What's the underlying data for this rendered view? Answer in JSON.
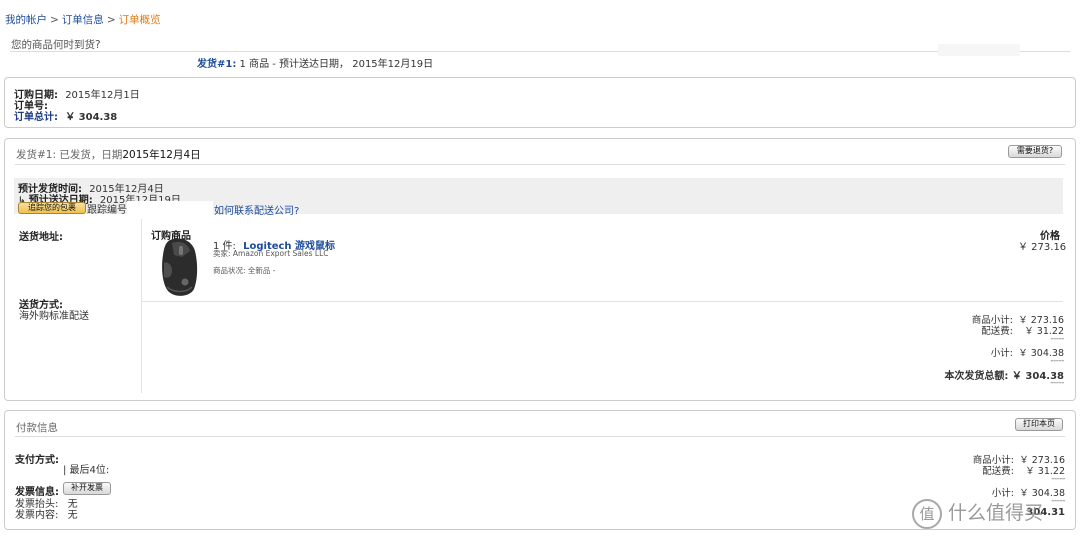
{
  "breadcrumb": {
    "account": "我的帐户",
    "order_info": "订单信息",
    "current": "订单概览",
    "sep": ">"
  },
  "delivery_question": "您的商品何时到货?",
  "shipment_summary": {
    "label": "发货#1:",
    "text": "1 商品 - 预计送达日期， 2015年12月19日"
  },
  "order_box": {
    "date_label": "订购日期:",
    "date_value": "2015年12月1日",
    "number_label": "订单号:",
    "number_value": "",
    "total_label": "订单总计:",
    "total_value": "￥ 304.38"
  },
  "shipment": {
    "header_prefix": "发货#1: 已发货，日期",
    "header_date": "2015年12月4日",
    "return_button": "需要退货?",
    "ship_time_label": "预计发货时间:",
    "ship_time_value": "2015年12月4日",
    "arrive_label": "预计送达日期:",
    "arrive_value": "2015年12月19日",
    "track_button": "追踪您的包裹",
    "tracking_label": "跟踪编号",
    "carrier_link": "如何联系配送公司?",
    "address_label": "送货地址:",
    "method_label": "送货方式:",
    "method_value": "海外购标准配送",
    "items_header": "订购商品",
    "price_header": "价格",
    "item_qty": "1 件:",
    "item_name": "Logitech 游戏鼠标",
    "seller": "卖家: Amazon Export Sales LLC",
    "condition": "商品状况: 全新品 -",
    "item_price": "￥ 273.16",
    "subtotal_label": "商品小计:",
    "subtotal_value": "￥ 273.16",
    "shipping_label": "配送费:",
    "shipping_value": "￥ 31.22",
    "sum_label": "小计:",
    "sum_value": "￥ 304.38",
    "total_label": "本次发货总额:",
    "total_value": "￥ 304.38",
    "dashes": "-----"
  },
  "payment": {
    "header": "付款信息",
    "print_button": "打印本页",
    "method_label": "支付方式:",
    "last4": "| 最后4位:",
    "invoice_label": "发票信息:",
    "invoice_button": "补开发票",
    "invoice_title_label": "发票抬头:",
    "invoice_title_value": "无",
    "invoice_content_label": "发票内容:",
    "invoice_content_value": "无",
    "subtotal_label": "商品小计:",
    "subtotal_value": "￥ 273.16",
    "shipping_label": "配送费:",
    "shipping_value": "￥ 31.22",
    "sum_label": "小计:",
    "sum_value": "￥ 304.38",
    "total_partial": "304.31"
  },
  "watermark": {
    "logo_char": "值",
    "text": "什么值得买"
  },
  "colors": {
    "link": "#1c4c9c",
    "breadcrumb_current": "#e47911",
    "button_yellow": "#f0c14b"
  }
}
